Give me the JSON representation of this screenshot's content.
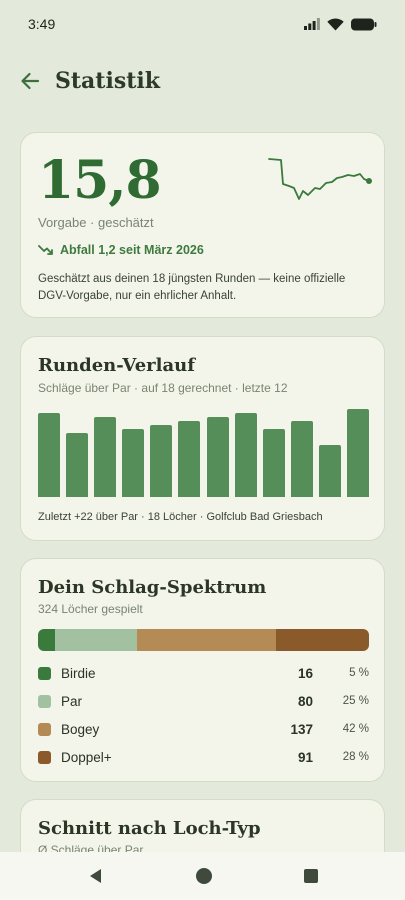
{
  "status": {
    "time": "3:49"
  },
  "header": {
    "title": "Statistik"
  },
  "vorgabe": {
    "value": "15,8",
    "label": "Vorgabe · geschätzt",
    "trend": "Abfall 1,2 seit März 2026",
    "note": "Geschätzt aus deinen 18 jüngsten Runden — keine offizielle DGV-Vorgabe, nur ein ehrlicher Anhalt."
  },
  "verlauf": {
    "title": "Runden-Verlauf",
    "subtitle": "Schläge über Par · auf 18 gerechnet · letzte 12",
    "footer": "Zuletzt +22 über Par · 18 Löcher · Golfclub Bad Griesbach",
    "bar_color": "#558e58"
  },
  "chart_data": {
    "type": "bar",
    "title": "Runden-Verlauf",
    "ylabel": "Schläge über Par",
    "values": [
      21,
      16,
      20,
      17,
      18,
      19,
      20,
      21,
      17,
      19,
      13,
      22
    ],
    "ylim": [
      0,
      22
    ]
  },
  "spektrum": {
    "title": "Dein Schlag-Spektrum",
    "subtitle": "324 Löcher gespielt",
    "items": [
      {
        "label": "Birdie",
        "count": "16",
        "pct": "5 %",
        "share": 5,
        "color": "#3a7a3d"
      },
      {
        "label": "Par",
        "count": "80",
        "pct": "25 %",
        "share": 25,
        "color": "#a2c1a0"
      },
      {
        "label": "Bogey",
        "count": "137",
        "pct": "42 %",
        "share": 42,
        "color": "#b48a55"
      },
      {
        "label": "Doppel+",
        "count": "91",
        "pct": "28 %",
        "share": 28,
        "color": "#8b5a2b"
      }
    ]
  },
  "lochtyp": {
    "title": "Schnitt nach Loch-Typ",
    "subtitle": "Ø Schläge über Par"
  },
  "icons": {
    "back": "arrow-left-icon",
    "trend": "trending-down-icon",
    "nav": [
      "nav-back-icon",
      "nav-home-icon",
      "nav-recents-icon"
    ]
  }
}
